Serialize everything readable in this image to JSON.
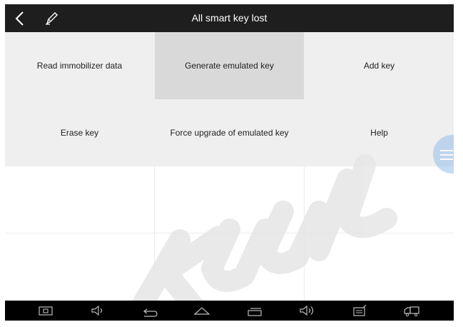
{
  "header": {
    "title": "All smart key lost",
    "back_icon": "chevron-left-icon",
    "edit_icon": "pencil-icon"
  },
  "menu": {
    "selected": "Generate emulated key",
    "items": [
      {
        "label": "Read immobilizer data"
      },
      {
        "label": "Generate emulated key"
      },
      {
        "label": "Add key"
      },
      {
        "label": "Erase key"
      },
      {
        "label": "Force upgrade of emulated key"
      },
      {
        "label": "Help"
      }
    ]
  },
  "navbar": {
    "icons": [
      "screenshot-icon",
      "volume-down-icon",
      "back-icon",
      "home-icon",
      "recent-apps-icon",
      "volume-up-icon",
      "vci-icon",
      "truck-icon"
    ]
  },
  "colors": {
    "header_bg": "#1e1e1e",
    "menu_bg": "#efefef",
    "selected_bg": "#d9d9d9",
    "navbar_bg": "#000000",
    "side_handle": "#96bee8"
  }
}
